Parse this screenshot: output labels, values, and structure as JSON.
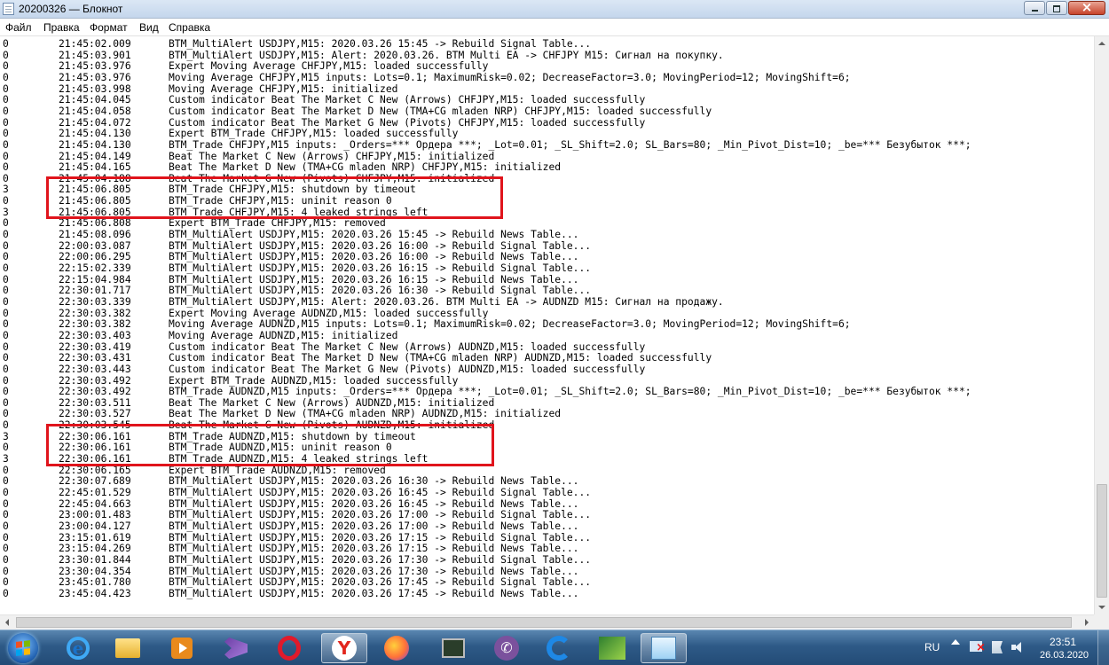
{
  "window": {
    "title": "20200326 — Блокнот"
  },
  "menu": [
    "Файл",
    "Правка",
    "Формат",
    "Вид",
    "Справка"
  ],
  "log": [
    {
      "level": "0",
      "time": "21:45:02.009",
      "msg": "BTM_MultiAlert USDJPY,M15: 2020.03.26 15:45 -> Rebuild Signal Table..."
    },
    {
      "level": "0",
      "time": "21:45:03.901",
      "msg": "BTM_MultiAlert USDJPY,M15: Alert: 2020.03.26. BTM Multi EA -> CHFJPY M15: Сигнал на покупку."
    },
    {
      "level": "0",
      "time": "21:45:03.976",
      "msg": "Expert Moving Average CHFJPY,M15: loaded successfully"
    },
    {
      "level": "0",
      "time": "21:45:03.976",
      "msg": "Moving Average CHFJPY,M15 inputs: Lots=0.1; MaximumRisk=0.02; DecreaseFactor=3.0; MovingPeriod=12; MovingShift=6;"
    },
    {
      "level": "0",
      "time": "21:45:03.998",
      "msg": "Moving Average CHFJPY,M15: initialized"
    },
    {
      "level": "0",
      "time": "21:45:04.045",
      "msg": "Custom indicator Beat The Market C New (Arrows) CHFJPY,M15: loaded successfully"
    },
    {
      "level": "0",
      "time": "21:45:04.058",
      "msg": "Custom indicator Beat The Market D New (TMA+CG mladen NRP) CHFJPY,M15: loaded successfully"
    },
    {
      "level": "0",
      "time": "21:45:04.072",
      "msg": "Custom indicator Beat The Market G New (Pivots) CHFJPY,M15: loaded successfully"
    },
    {
      "level": "0",
      "time": "21:45:04.130",
      "msg": "Expert BTM_Trade CHFJPY,M15: loaded successfully"
    },
    {
      "level": "0",
      "time": "21:45:04.130",
      "msg": "BTM_Trade CHFJPY,M15 inputs: _Orders=*** Ордера ***; _Lot=0.01; _SL_Shift=2.0; SL_Bars=80; _Min_Pivot_Dist=10; _be=*** Безубыток ***;"
    },
    {
      "level": "0",
      "time": "21:45:04.149",
      "msg": "Beat The Market C New (Arrows) CHFJPY,M15: initialized"
    },
    {
      "level": "0",
      "time": "21:45:04.165",
      "msg": "Beat The Market D New (TMA+CG mladen NRP) CHFJPY,M15: initialized"
    },
    {
      "level": "0",
      "time": "21:45:04.188",
      "msg": "Beat The Market G New (Pivots) CHFJPY,M15: initialized"
    },
    {
      "level": "3",
      "time": "21:45:06.805",
      "msg": "BTM_Trade CHFJPY,M15: shutdown by timeout"
    },
    {
      "level": "0",
      "time": "21:45:06.805",
      "msg": "BTM_Trade CHFJPY,M15: uninit reason 0"
    },
    {
      "level": "3",
      "time": "21:45:06.805",
      "msg": "BTM_Trade CHFJPY,M15: 4 leaked strings left"
    },
    {
      "level": "0",
      "time": "21:45:06.808",
      "msg": "Expert BTM_Trade CHFJPY,M15: removed"
    },
    {
      "level": "0",
      "time": "21:45:08.096",
      "msg": "BTM_MultiAlert USDJPY,M15: 2020.03.26 15:45 -> Rebuild News Table..."
    },
    {
      "level": "0",
      "time": "22:00:03.087",
      "msg": "BTM_MultiAlert USDJPY,M15: 2020.03.26 16:00 -> Rebuild Signal Table..."
    },
    {
      "level": "0",
      "time": "22:00:06.295",
      "msg": "BTM_MultiAlert USDJPY,M15: 2020.03.26 16:00 -> Rebuild News Table..."
    },
    {
      "level": "0",
      "time": "22:15:02.339",
      "msg": "BTM_MultiAlert USDJPY,M15: 2020.03.26 16:15 -> Rebuild Signal Table..."
    },
    {
      "level": "0",
      "time": "22:15:04.984",
      "msg": "BTM_MultiAlert USDJPY,M15: 2020.03.26 16:15 -> Rebuild News Table..."
    },
    {
      "level": "0",
      "time": "22:30:01.717",
      "msg": "BTM_MultiAlert USDJPY,M15: 2020.03.26 16:30 -> Rebuild Signal Table..."
    },
    {
      "level": "0",
      "time": "22:30:03.339",
      "msg": "BTM_MultiAlert USDJPY,M15: Alert: 2020.03.26. BTM Multi EA -> AUDNZD M15: Сигнал на продажу."
    },
    {
      "level": "0",
      "time": "22:30:03.382",
      "msg": "Expert Moving Average AUDNZD,M15: loaded successfully"
    },
    {
      "level": "0",
      "time": "22:30:03.382",
      "msg": "Moving Average AUDNZD,M15 inputs: Lots=0.1; MaximumRisk=0.02; DecreaseFactor=3.0; MovingPeriod=12; MovingShift=6;"
    },
    {
      "level": "0",
      "time": "22:30:03.403",
      "msg": "Moving Average AUDNZD,M15: initialized"
    },
    {
      "level": "0",
      "time": "22:30:03.419",
      "msg": "Custom indicator Beat The Market C New (Arrows) AUDNZD,M15: loaded successfully"
    },
    {
      "level": "0",
      "time": "22:30:03.431",
      "msg": "Custom indicator Beat The Market D New (TMA+CG mladen NRP) AUDNZD,M15: loaded successfully"
    },
    {
      "level": "0",
      "time": "22:30:03.443",
      "msg": "Custom indicator Beat The Market G New (Pivots) AUDNZD,M15: loaded successfully"
    },
    {
      "level": "0",
      "time": "22:30:03.492",
      "msg": "Expert BTM_Trade AUDNZD,M15: loaded successfully"
    },
    {
      "level": "0",
      "time": "22:30:03.492",
      "msg": "BTM_Trade AUDNZD,M15 inputs: _Orders=*** Ордера ***; _Lot=0.01; _SL_Shift=2.0; SL_Bars=80; _Min_Pivot_Dist=10; _be=*** Безубыток ***;"
    },
    {
      "level": "0",
      "time": "22:30:03.511",
      "msg": "Beat The Market C New (Arrows) AUDNZD,M15: initialized"
    },
    {
      "level": "0",
      "time": "22:30:03.527",
      "msg": "Beat The Market D New (TMA+CG mladen NRP) AUDNZD,M15: initialized"
    },
    {
      "level": "0",
      "time": "22:30:03.545",
      "msg": "Beat The Market G New (Pivots) AUDNZD,M15: initialized"
    },
    {
      "level": "3",
      "time": "22:30:06.161",
      "msg": "BTM_Trade AUDNZD,M15: shutdown by timeout"
    },
    {
      "level": "0",
      "time": "22:30:06.161",
      "msg": "BTM_Trade AUDNZD,M15: uninit reason 0"
    },
    {
      "level": "3",
      "time": "22:30:06.161",
      "msg": "BTM_Trade AUDNZD,M15: 4 leaked strings left"
    },
    {
      "level": "0",
      "time": "22:30:06.165",
      "msg": "Expert BTM_Trade AUDNZD,M15: removed"
    },
    {
      "level": "0",
      "time": "22:30:07.689",
      "msg": "BTM_MultiAlert USDJPY,M15: 2020.03.26 16:30 -> Rebuild News Table..."
    },
    {
      "level": "0",
      "time": "22:45:01.529",
      "msg": "BTM_MultiAlert USDJPY,M15: 2020.03.26 16:45 -> Rebuild Signal Table..."
    },
    {
      "level": "0",
      "time": "22:45:04.663",
      "msg": "BTM_MultiAlert USDJPY,M15: 2020.03.26 16:45 -> Rebuild News Table..."
    },
    {
      "level": "0",
      "time": "23:00:01.483",
      "msg": "BTM_MultiAlert USDJPY,M15: 2020.03.26 17:00 -> Rebuild Signal Table..."
    },
    {
      "level": "0",
      "time": "23:00:04.127",
      "msg": "BTM_MultiAlert USDJPY,M15: 2020.03.26 17:00 -> Rebuild News Table..."
    },
    {
      "level": "0",
      "time": "23:15:01.619",
      "msg": "BTM_MultiAlert USDJPY,M15: 2020.03.26 17:15 -> Rebuild Signal Table..."
    },
    {
      "level": "0",
      "time": "23:15:04.269",
      "msg": "BTM_MultiAlert USDJPY,M15: 2020.03.26 17:15 -> Rebuild News Table..."
    },
    {
      "level": "0",
      "time": "23:30:01.844",
      "msg": "BTM_MultiAlert USDJPY,M15: 2020.03.26 17:30 -> Rebuild Signal Table..."
    },
    {
      "level": "0",
      "time": "23:30:04.354",
      "msg": "BTM_MultiAlert USDJPY,M15: 2020.03.26 17:30 -> Rebuild News Table..."
    },
    {
      "level": "0",
      "time": "23:45:01.780",
      "msg": "BTM_MultiAlert USDJPY,M15: 2020.03.26 17:45 -> Rebuild Signal Table..."
    },
    {
      "level": "0",
      "time": "23:45:04.423",
      "msg": "BTM_MultiAlert USDJPY,M15: 2020.03.26 17:45 -> Rebuild News Table..."
    }
  ],
  "highlight_color": "#e0141c",
  "taskbar": {
    "icons": [
      "start-orb-icon",
      "internet-explorer-icon",
      "file-explorer-icon",
      "media-player-icon",
      "visual-studio-icon",
      "opera-icon",
      "yandex-browser-icon",
      "firefox-icon",
      "task-manager-icon",
      "viber-icon",
      "g-app-icon",
      "metatrader-icon",
      "notepad-icon"
    ],
    "language": "RU",
    "time": "23:51",
    "date": "26.03.2020"
  }
}
